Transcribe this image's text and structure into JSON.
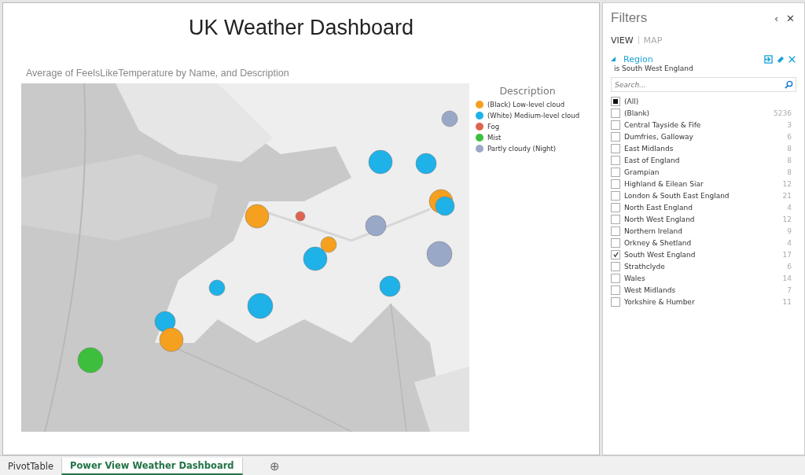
{
  "dashboard": {
    "title": "UK Weather Dashboard"
  },
  "map_chart": {
    "title": "Average of FeelsLikeTemperature by Name, and Description",
    "kind": "picture",
    "legend": {
      "title": "Description",
      "items": [
        {
          "label": "(Black) Low-level cloud",
          "color": "#f5a01f"
        },
        {
          "label": "(White) Medium-level cloud",
          "color": "#1eb2e8"
        },
        {
          "label": "Fog",
          "color": "#de6450"
        },
        {
          "label": "Mist",
          "color": "#3dbf3d"
        },
        {
          "label": "Partly cloudy (Night)",
          "color": "#9aa8c8"
        }
      ]
    },
    "bubbles": [
      {
        "color": "#1eb2e8"
      },
      {
        "color": "#1eb2e8"
      },
      {
        "color": "#9aa8c8"
      },
      {
        "color": "#f5a01f"
      },
      {
        "color": "#1eb2e8"
      },
      {
        "color": "#f5a01f"
      },
      {
        "color": "#de6450"
      },
      {
        "color": "#9aa8c8"
      },
      {
        "color": "#f5a01f"
      },
      {
        "color": "#9aa8c8"
      },
      {
        "color": "#1eb2e8"
      },
      {
        "color": "#1eb2e8"
      },
      {
        "color": "#1eb2e8"
      },
      {
        "color": "#1eb2e8"
      },
      {
        "color": "#1eb2e8"
      },
      {
        "color": "#f5a01f"
      },
      {
        "color": "#3dbf3d"
      }
    ]
  },
  "filters": {
    "title": "Filters",
    "collapse": "‹",
    "close": "✕",
    "tabs": [
      {
        "label": "VIEW",
        "selected": true
      },
      {
        "label": "MAP",
        "selected": false
      }
    ],
    "field": {
      "name": "Region",
      "expanded": true,
      "summary": "is South West England",
      "search": {
        "placeholder": "Search..."
      },
      "items": [
        {
          "label": "(All)",
          "checked": false,
          "indeterminate": true
        },
        {
          "label": "(Blank)",
          "count": "5236",
          "checked": false,
          "indeterminate": false
        },
        {
          "label": "Central Tayside & Fife",
          "count": "3",
          "checked": false,
          "indeterminate": false
        },
        {
          "label": "Dumfries, Galloway",
          "count": "6",
          "checked": false,
          "indeterminate": false
        },
        {
          "label": "East Midlands",
          "count": "8",
          "checked": false,
          "indeterminate": false
        },
        {
          "label": "East of England",
          "count": "8",
          "checked": false,
          "indeterminate": false
        },
        {
          "label": "Grampian",
          "count": "8",
          "checked": false,
          "indeterminate": false
        },
        {
          "label": "Highland & Eilean Siar",
          "count": "12",
          "checked": false,
          "indeterminate": false
        },
        {
          "label": "London & South East England",
          "count": "21",
          "checked": false,
          "indeterminate": false
        },
        {
          "label": "North East England",
          "count": "4",
          "checked": false,
          "indeterminate": false
        },
        {
          "label": "North West England",
          "count": "12",
          "checked": false,
          "indeterminate": false
        },
        {
          "label": "Northern Ireland",
          "count": "9",
          "checked": false,
          "indeterminate": false
        },
        {
          "label": "Orkney & Shetland",
          "count": "4",
          "checked": false,
          "indeterminate": false
        },
        {
          "label": "South West England",
          "count": "17",
          "checked": true,
          "indeterminate": false
        },
        {
          "label": "Strathclyde",
          "count": "6",
          "checked": false,
          "indeterminate": false
        },
        {
          "label": "Wales",
          "count": "14",
          "checked": false,
          "indeterminate": false
        },
        {
          "label": "West Midlands",
          "count": "7",
          "checked": false,
          "indeterminate": false
        },
        {
          "label": "Yorkshire & Humber",
          "count": "11",
          "checked": false,
          "indeterminate": false
        }
      ]
    }
  },
  "sheet_tabs": [
    {
      "label": "PivotTable",
      "selected": false
    },
    {
      "label": "Power View Weather Dashboard",
      "selected": true
    }
  ],
  "add_sheet": "⊕"
}
